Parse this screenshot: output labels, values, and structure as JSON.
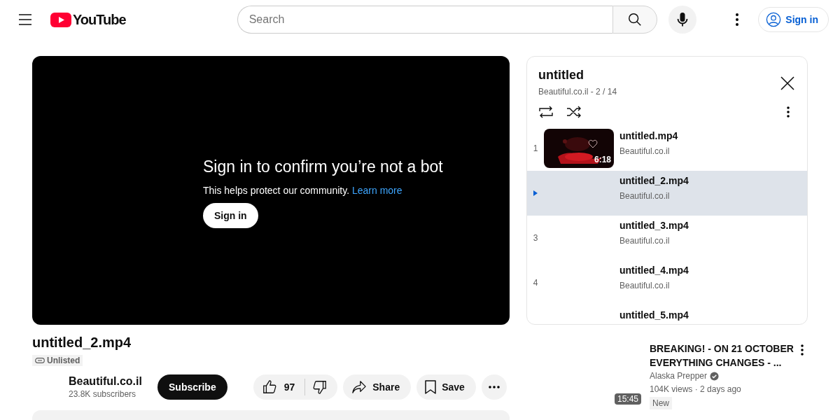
{
  "header": {
    "logo": "YouTube",
    "search": {
      "placeholder": "Search"
    },
    "sign_in": "Sign in"
  },
  "player": {
    "heading": "Sign in to confirm you’re not a bot",
    "message": "This helps protect our community.",
    "link": "Learn more",
    "button": "Sign in"
  },
  "video": {
    "title": "untitled_2.mp4",
    "visibility": "Unlisted",
    "channel": "Beautiful.co.il",
    "subscribers": "23.8K subscribers",
    "subscribe": "Subscribe",
    "likes": "97",
    "share": "Share",
    "save": "Save"
  },
  "playlist": {
    "title": "untitled",
    "meta": "Beautiful.co.il - 2 / 14",
    "items": [
      {
        "index": "1",
        "title": "untitled.mp4",
        "channel": "Beautiful.co.il",
        "selected": false,
        "thumbnail": {
          "kind": "picture",
          "duration": "6:18"
        }
      },
      {
        "title": "untitled_2.mp4",
        "channel": "Beautiful.co.il",
        "selected": true
      },
      {
        "index": "3",
        "title": "untitled_3.mp4",
        "channel": "Beautiful.co.il",
        "selected": false
      },
      {
        "index": "4",
        "title": "untitled_4.mp4",
        "channel": "Beautiful.co.il",
        "selected": false
      },
      {
        "title": "untitled_5.mp4",
        "selected": false
      }
    ]
  },
  "recommendations": [
    {
      "title": "BREAKING! - ON 21 OCTOBER EVERYTHING CHANGES - ...",
      "channel": "Alaska Prepper",
      "verified": true,
      "meta": "104K views · 2 days ago",
      "badge": "New",
      "duration": "15:45"
    }
  ]
}
